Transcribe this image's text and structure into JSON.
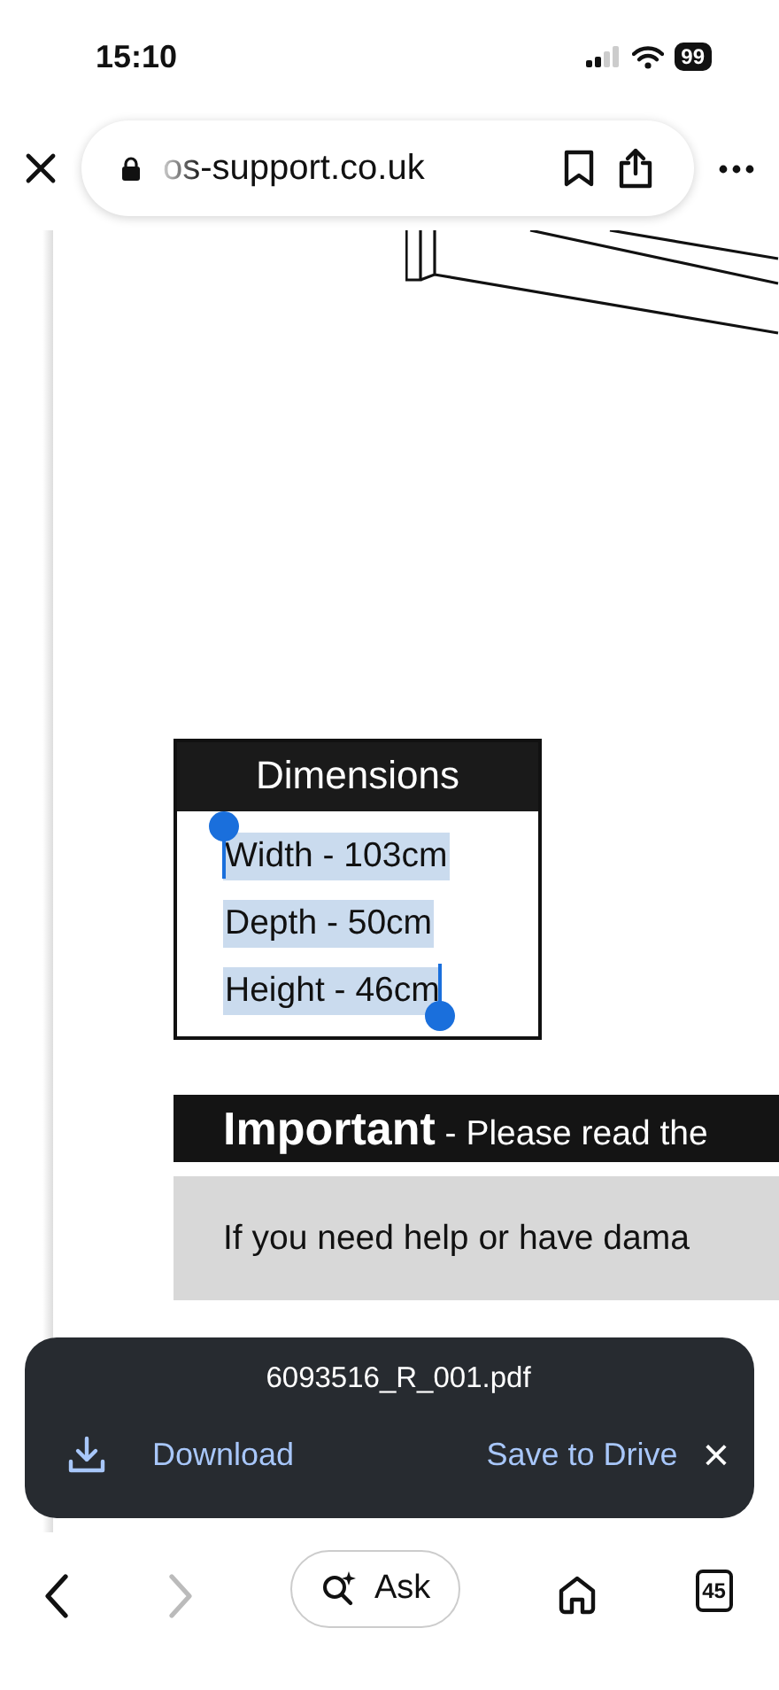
{
  "status_bar": {
    "time": "15:10",
    "battery": "99"
  },
  "address_bar": {
    "url": "os-support.co.uk"
  },
  "document": {
    "dimensions": {
      "title": "Dimensions",
      "rows": [
        {
          "text": "Width - 103cm",
          "selected": true
        },
        {
          "text": "Depth - 50cm",
          "selected": true
        },
        {
          "text": "Height - 46cm",
          "selected": true
        }
      ]
    },
    "important": {
      "text": "**Important** - Please read the"
    },
    "notice": "If you need help or have dama"
  },
  "download_toast": {
    "filename": "6093516_R_001.pdf",
    "download": "Download",
    "save": "Save to Drive",
    "close": "×"
  },
  "bottom_nav": {
    "back_disabled": false,
    "forward_disabled": true,
    "ask": "Ask",
    "tab_count": "45"
  }
}
